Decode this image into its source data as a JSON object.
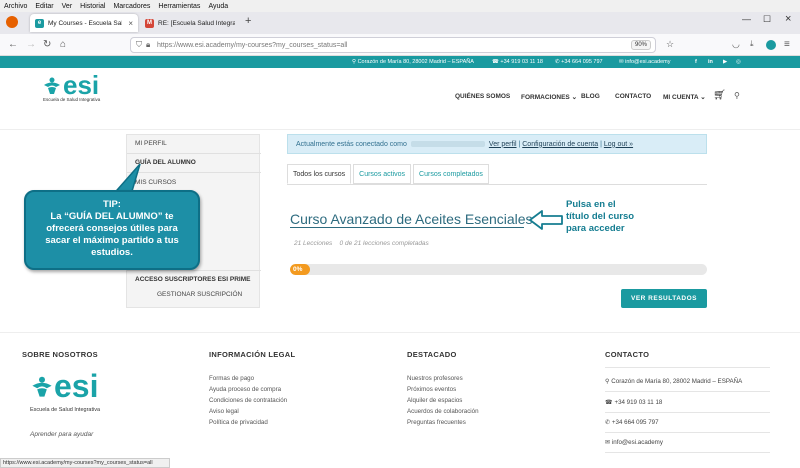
{
  "browser": {
    "menu": [
      "Archivo",
      "Editar",
      "Ver",
      "Historial",
      "Marcadores",
      "Herramientas",
      "Ayuda"
    ],
    "tabs": [
      {
        "title": "My Courses - Escuela Salud Inte",
        "active": true
      },
      {
        "title": "RE: [Escuela Salud Integrativa] I",
        "active": false
      }
    ],
    "url": "https://www.esi.academy/my-courses?my_courses_status=all",
    "zoom": "90%",
    "status_url": "https://www.esi.academy/my-courses?my_courses_status=all"
  },
  "topbar": {
    "address": "Corazón de María 80, 28002 Madrid – ESPAÑA",
    "phone1": "+34 919 03 11 18",
    "phone2": "+34 664 095 797",
    "email": "info@esi.academy"
  },
  "header": {
    "logo_text": "esi",
    "logo_sub": "Escuela de Salud Integrativa",
    "nav": [
      "QUIÉNES SOMOS",
      "FORMACIONES",
      "BLOG",
      "CONTACTO",
      "MI CUENTA"
    ]
  },
  "sidebar": {
    "items": [
      "MI PERFIL",
      "GUÍA DEL ALUMNO",
      "MIS CURSOS",
      "ACCESO SUSCRIPTORES ESI PRIME",
      "GESTIONAR SUSCRIPCIÓN"
    ]
  },
  "tip": {
    "line1": "TIP:",
    "line2": "La “GUÍA DEL ALUMNO” te",
    "line3": "ofrecerá consejos útiles para",
    "line4": "sacar el máximo partido a tus",
    "line5": "estudios."
  },
  "notice": {
    "prefix": "Actualmente estás conectado como",
    "link1": "Ver perfil",
    "link2": "Configuración de cuenta",
    "link3": "Log out »"
  },
  "course_tabs": [
    "Todos los cursos",
    "Cursos activos",
    "Cursos completados"
  ],
  "course": {
    "title": "Curso Avanzado de Aceites Esenciales",
    "lessons": "21 Lecciones",
    "completed": "0 de 21 lecciones completadas",
    "progress_label": "0%",
    "progress_fraction": 0.02,
    "results_button": "VER RESULTADOS"
  },
  "hint": {
    "line1": "Pulsa en el",
    "line2": "título del curso",
    "line3": "para acceder"
  },
  "footer": {
    "about_title": "SOBRE NOSOTROS",
    "about_logo": "esi",
    "about_logo_sub": "Escuela de Salud Integrativa",
    "about_tagline": "Aprender para ayudar",
    "legal_title": "INFORMACIÓN LEGAL",
    "legal_links": [
      "Formas de pago",
      "Ayuda proceso de compra",
      "Condiciones de contratación",
      "Aviso legal",
      "Política de privacidad"
    ],
    "featured_title": "DESTACADO",
    "featured_links": [
      "Nuestros profesores",
      "Próximos eventos",
      "Alquiler de espacios",
      "Acuerdos de colaboración",
      "Preguntas frecuentes"
    ],
    "contact_title": "CONTACTO",
    "contact": [
      "Corazón de María 80, 28002 Madrid – ESPAÑA",
      "+34 919 03 11 18",
      "+34 664 095 797",
      "info@esi.academy"
    ]
  },
  "colors": {
    "brand": "#1a9aa0",
    "accent_orange": "#f39a1f",
    "tip_bg": "#1d8fa6"
  }
}
